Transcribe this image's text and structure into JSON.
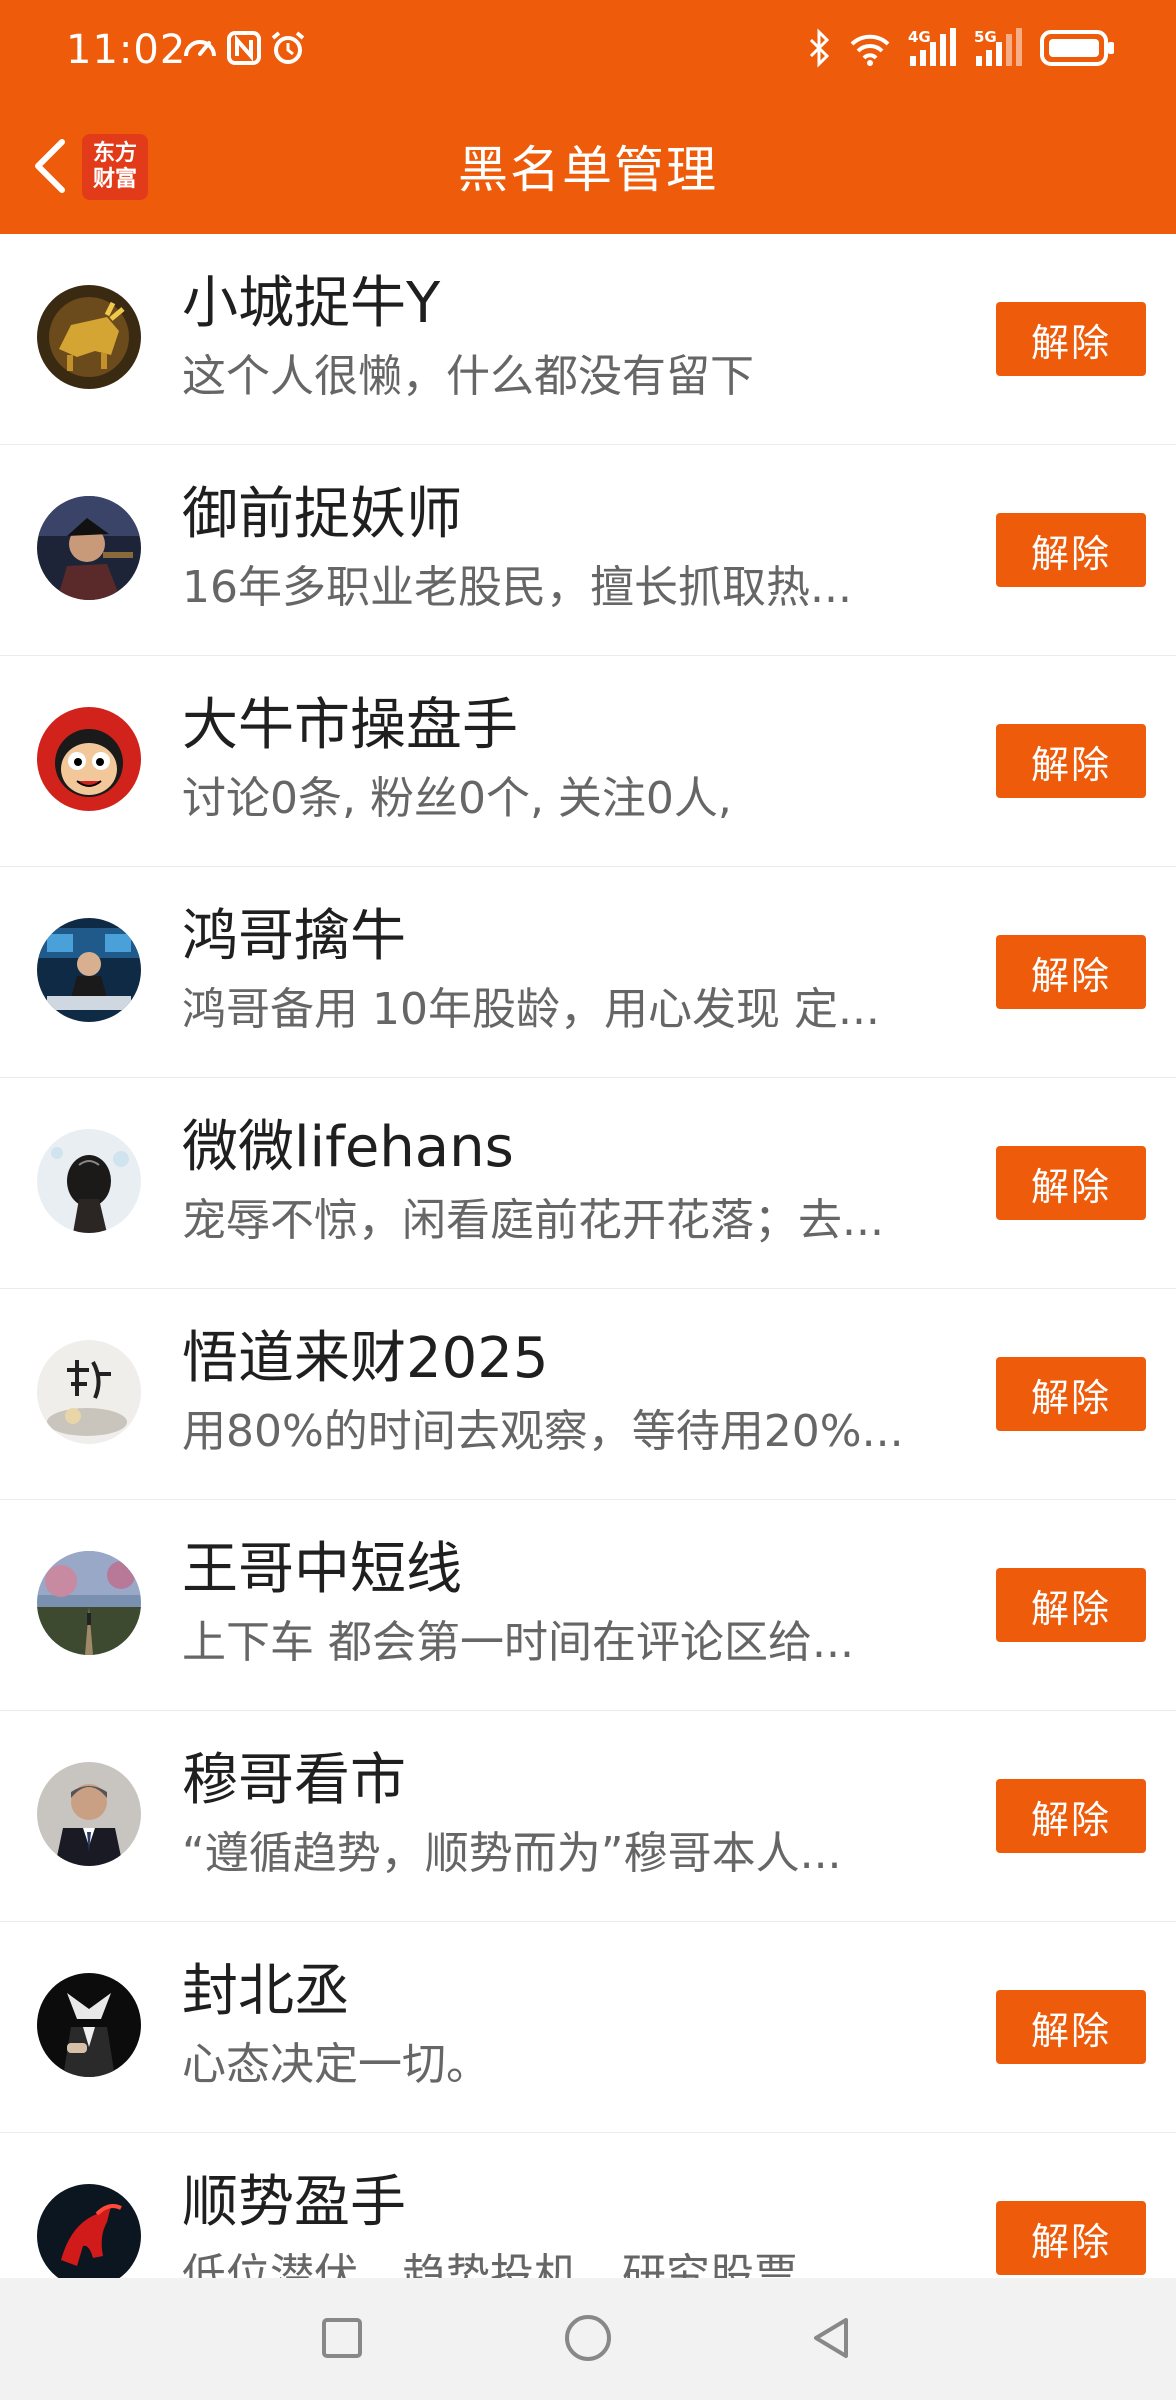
{
  "status_bar": {
    "time": "11:02",
    "left_icons": [
      "speedometer-icon",
      "nfc-icon",
      "alarm-icon"
    ],
    "right_icons": [
      "bluetooth-icon",
      "wifi-icon",
      "signal-4g-icon",
      "signal-5g-icon",
      "battery-icon"
    ]
  },
  "header": {
    "back_icon": "chevron-left-icon",
    "logo_line1": "东方",
    "logo_line2": "财富",
    "title": "黑名单管理"
  },
  "colors": {
    "accent": "#ee5b0a"
  },
  "blacklist": [
    {
      "name": "小城捉牛Y",
      "desc": "这个人很懒，什么都没有留下",
      "action": "解除",
      "avatar": "golden-bull-avatar"
    },
    {
      "name": "御前捉妖师",
      "desc": "16年多职业老股民，擅长抓取热...",
      "action": "解除",
      "avatar": "person-photo-avatar"
    },
    {
      "name": "大牛市操盘手",
      "desc": "讨论0条, 粉丝0个, 关注0人,",
      "action": "解除",
      "avatar": "cartoon-face-avatar"
    },
    {
      "name": "鸿哥擒牛",
      "desc": "鸿哥备用 10年股龄，用心发现 定...",
      "action": "解除",
      "avatar": "trader-desk-avatar"
    },
    {
      "name": "微微lifehans",
      "desc": "宠辱不惊，闲看庭前花开花落；去...",
      "action": "解除",
      "avatar": "woman-back-avatar"
    },
    {
      "name": "悟道来财2025",
      "desc": "用80%的时间去观察，等待用20%...",
      "action": "解除",
      "avatar": "calligraphy-avatar"
    },
    {
      "name": "王哥中短线",
      "desc": "上下车 都会第一时间在评论区给...",
      "action": "解除",
      "avatar": "landscape-avatar"
    },
    {
      "name": "穆哥看市",
      "desc": "“遵循趋势，顺势而为”穆哥本人...",
      "action": "解除",
      "avatar": "man-suit-avatar"
    },
    {
      "name": "封北丞",
      "desc": "心态决定一切。",
      "action": "解除",
      "avatar": "dark-portrait-avatar"
    },
    {
      "name": "顺势盈手",
      "desc": "低位潜伏，趋势投机，研究股票",
      "action": "解除",
      "avatar": "red-horse-avatar"
    }
  ],
  "system_nav": {
    "icons": [
      "square-recents-icon",
      "circle-home-icon",
      "triangle-back-icon"
    ]
  }
}
